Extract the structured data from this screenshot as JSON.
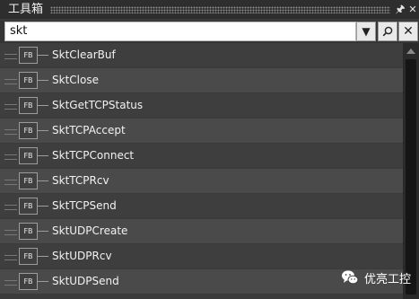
{
  "window": {
    "title": "工具箱",
    "pin_icon": "pin-icon",
    "close_icon": "close-icon"
  },
  "search": {
    "value": "skt",
    "dropdown_icon": "chevron-down-icon",
    "find_icon": "search-icon",
    "clear_icon": "close-icon"
  },
  "items": [
    {
      "badge": "FB",
      "label": "SktClearBuf"
    },
    {
      "badge": "FB",
      "label": "SktClose"
    },
    {
      "badge": "FB",
      "label": "SktGetTCPStatus"
    },
    {
      "badge": "FB",
      "label": "SktTCPAccept"
    },
    {
      "badge": "FB",
      "label": "SktTCPConnect"
    },
    {
      "badge": "FB",
      "label": "SktTCPRcv"
    },
    {
      "badge": "FB",
      "label": "SktTCPSend"
    },
    {
      "badge": "FB",
      "label": "SktUDPCreate"
    },
    {
      "badge": "FB",
      "label": "SktUDPRcv"
    },
    {
      "badge": "FB",
      "label": "SktUDPSend"
    }
  ],
  "watermark": {
    "text": "优亮工控"
  },
  "colors": {
    "title_bar": "#2e2e2e",
    "row_light": "#4a4a4a",
    "row_dark": "#3e3e3e",
    "text": "#f2f2f2"
  }
}
